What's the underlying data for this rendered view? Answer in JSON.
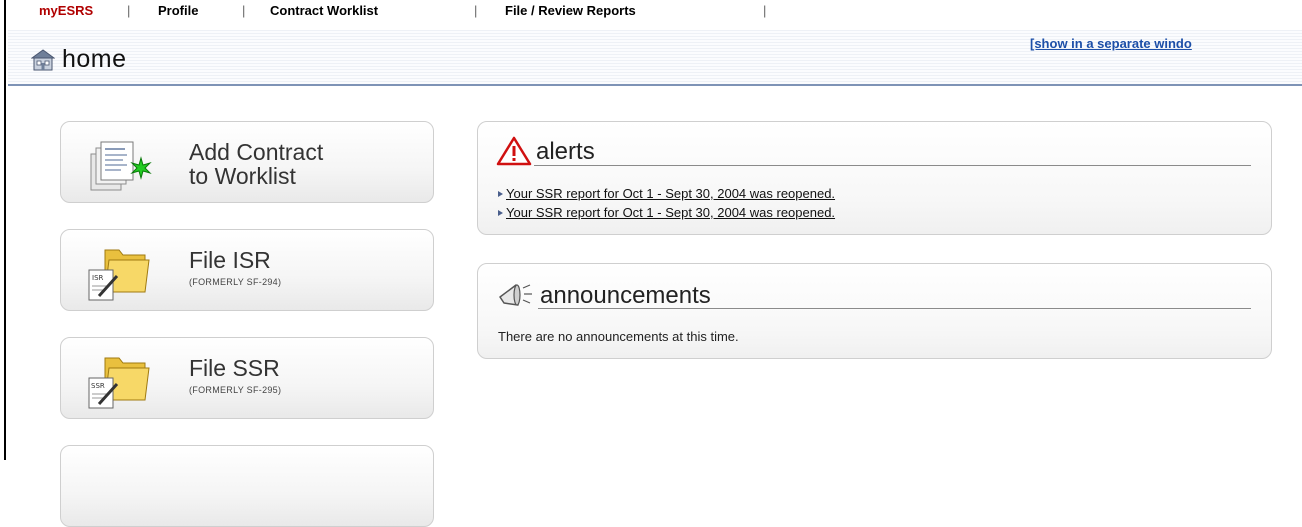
{
  "nav": {
    "items": [
      "myESRS",
      "Profile",
      "Contract Worklist",
      "File / Review Reports"
    ],
    "separator": "|"
  },
  "header": {
    "title": "home",
    "separate_window_link": "[show in a separate windo"
  },
  "cards": [
    {
      "title_line1": "Add Contract",
      "title_line2": "to Worklist",
      "icon": "add-contract-icon"
    },
    {
      "title_line1": "File ISR",
      "subtitle": "(FORMERLY SF-294)",
      "icon": "isr-folder-icon",
      "icon_label": "ISR"
    },
    {
      "title_line1": "File SSR",
      "subtitle": "(FORMERLY SF-295)",
      "icon": "ssr-folder-icon",
      "icon_label": "SSR"
    }
  ],
  "alerts": {
    "title": "alerts",
    "items": [
      "Your SSR report for Oct 1 - Sept 30, 2004 was reopened.",
      "Your SSR report for Oct 1 - Sept 30, 2004 was reopened."
    ]
  },
  "announcements": {
    "title": "announcements",
    "message": "There are no announcements at this time."
  },
  "colors": {
    "nav_active": "#b00000",
    "link": "#1d4fa8",
    "header_rule": "#7e93b6",
    "alert_icon": "#d01010"
  }
}
